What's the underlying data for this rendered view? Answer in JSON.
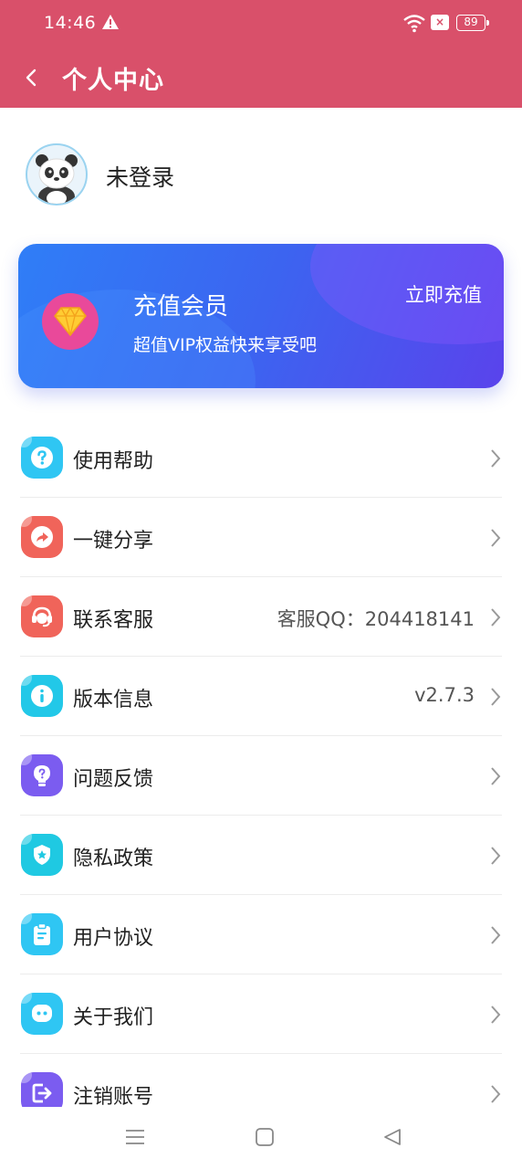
{
  "status_bar": {
    "time": "14:46",
    "battery": "89"
  },
  "header": {
    "title": "个人中心"
  },
  "profile": {
    "name": "未登录"
  },
  "vip": {
    "title": "充值会员",
    "subtitle": "超值VIP权益快来享受吧",
    "button": "立即充值"
  },
  "menu": {
    "items": [
      {
        "label": "使用帮助",
        "value": "",
        "icon": "help-icon",
        "color": "#2fc6f3"
      },
      {
        "label": "一键分享",
        "value": "",
        "icon": "share-icon",
        "color": "#f0645a"
      },
      {
        "label": "联系客服",
        "value": "客服QQ：204418141",
        "icon": "customer-service-icon",
        "color": "#f0645a"
      },
      {
        "label": "版本信息",
        "value": "v2.7.3",
        "icon": "info-icon",
        "color": "#22c8e8"
      },
      {
        "label": "问题反馈",
        "value": "",
        "icon": "feedback-bulb-icon",
        "color": "#7b5cf0"
      },
      {
        "label": "隐私政策",
        "value": "",
        "icon": "privacy-shield-icon",
        "color": "#1fc9e2"
      },
      {
        "label": "用户协议",
        "value": "",
        "icon": "agreement-clipboard-icon",
        "color": "#2fc6f3"
      },
      {
        "label": "关于我们",
        "value": "",
        "icon": "about-chat-icon",
        "color": "#2fc6f3"
      },
      {
        "label": "注销账号",
        "value": "",
        "icon": "logout-icon",
        "color": "#7b5cf0"
      }
    ]
  },
  "colors": {
    "header_bg": "#d9506a",
    "vip_gradient_start": "#2f7ef7",
    "vip_gradient_end": "#5a43ec"
  }
}
